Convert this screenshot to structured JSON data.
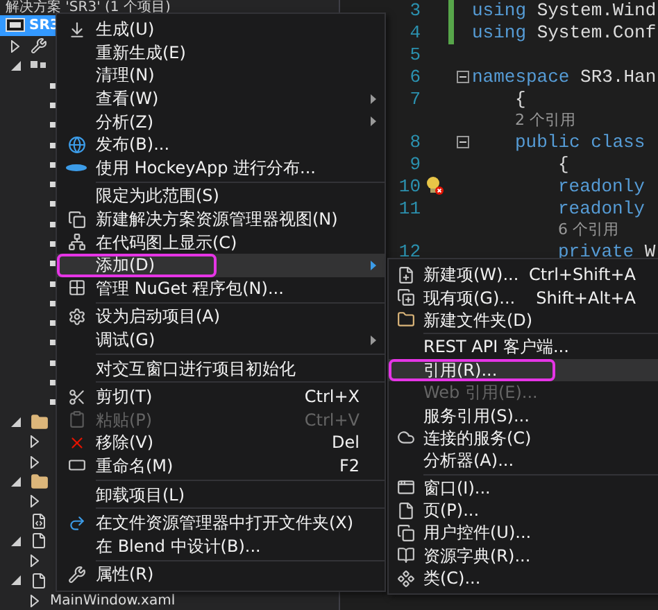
{
  "solution_explorer": {
    "header": "解决方案 'SR3' (1 个项目)",
    "project": {
      "label": "SR3",
      "selected": true
    },
    "items": [
      {
        "kind": "properties",
        "expanded": false
      },
      {
        "kind": "references",
        "expanded": true,
        "children": [
          {
            "kind": "reference"
          },
          {
            "kind": "reference"
          },
          {
            "kind": "reference"
          },
          {
            "kind": "reference"
          },
          {
            "kind": "reference"
          },
          {
            "kind": "reference"
          },
          {
            "kind": "reference"
          },
          {
            "kind": "reference"
          },
          {
            "kind": "reference"
          },
          {
            "kind": "reference"
          },
          {
            "kind": "reference"
          },
          {
            "kind": "reference"
          },
          {
            "kind": "reference"
          },
          {
            "kind": "reference"
          },
          {
            "kind": "reference"
          },
          {
            "kind": "reference"
          },
          {
            "kind": "reference"
          }
        ]
      },
      {
        "kind": "folder",
        "expanded": true,
        "children": [
          {
            "kind": "hidden",
            "expanded": false
          },
          {
            "kind": "hidden",
            "expanded": false
          }
        ]
      },
      {
        "kind": "folder",
        "expanded": true,
        "children": [
          {
            "kind": "hidden",
            "expanded": false
          }
        ]
      },
      {
        "kind": "config"
      },
      {
        "kind": "file",
        "expanded": true,
        "children": [
          {
            "kind": "hidden",
            "expanded": false
          }
        ]
      },
      {
        "kind": "file",
        "expanded": true,
        "children": [
          {
            "kind": "hidden",
            "expanded": false,
            "label": "MainWindow.xaml"
          }
        ]
      }
    ]
  },
  "editor": {
    "lines": [
      {
        "kind": "code",
        "number": "3",
        "keyword": "using",
        "rest": " System.Wind",
        "modified": true
      },
      {
        "kind": "code",
        "number": "4",
        "keyword": "using",
        "rest": " System.Conf",
        "modified": true
      },
      {
        "kind": "code",
        "number": "5",
        "modified": false
      },
      {
        "kind": "code",
        "number": "6",
        "keyword": "namespace",
        "rest": " SR3.Han",
        "modified": false,
        "children": [
          {
            "kind": "code",
            "number": "7",
            "rest": "{",
            "modified": false
          },
          {
            "kind": "lens",
            "text": "2 个引用"
          },
          {
            "kind": "code",
            "number": "8",
            "keyword": "public class",
            "modified": false,
            "children": [
              {
                "kind": "code",
                "number": "9",
                "rest": "{",
                "modified": false
              },
              {
                "kind": "code",
                "number": "10",
                "keyword": "readonly",
                "modified": false,
                "lightbulb": true
              },
              {
                "kind": "code",
                "number": "11",
                "keyword": "readonly",
                "modified": false
              },
              {
                "kind": "lens",
                "text": "6 个引用"
              },
              {
                "kind": "code",
                "number": "12",
                "keyword": "private",
                "rest": " W",
                "modified": false
              }
            ]
          }
        ]
      }
    ]
  },
  "context_menu": [
    {
      "kind": "item",
      "label": "生成(U)",
      "disabled": false,
      "has_submenu": false,
      "selected": false,
      "outlined": false
    },
    {
      "kind": "item",
      "label": "重新生成(E)",
      "disabled": false,
      "has_submenu": false,
      "selected": false,
      "outlined": false
    },
    {
      "kind": "item",
      "label": "清理(N)",
      "disabled": false,
      "has_submenu": false,
      "selected": false,
      "outlined": false
    },
    {
      "kind": "item",
      "label": "查看(W)",
      "disabled": false,
      "has_submenu": true,
      "selected": false,
      "outlined": false
    },
    {
      "kind": "item",
      "label": "分析(Z)",
      "disabled": false,
      "has_submenu": true,
      "selected": false,
      "outlined": false
    },
    {
      "kind": "item",
      "label": "发布(B)...",
      "disabled": false,
      "has_submenu": false,
      "selected": false,
      "outlined": false
    },
    {
      "kind": "item",
      "label": "使用 HockeyApp 进行分布...",
      "disabled": false,
      "has_submenu": false,
      "selected": false,
      "outlined": false
    },
    {
      "kind": "separator"
    },
    {
      "kind": "item",
      "label": "限定为此范围(S)",
      "disabled": false,
      "has_submenu": false,
      "selected": false,
      "outlined": false
    },
    {
      "kind": "item",
      "label": "新建解决方案资源管理器视图(N)",
      "disabled": false,
      "has_submenu": false,
      "selected": false,
      "outlined": false
    },
    {
      "kind": "item",
      "label": "在代码图上显示(C)",
      "disabled": false,
      "has_submenu": false,
      "selected": false,
      "outlined": false
    },
    {
      "kind": "item",
      "label": "添加(D)",
      "disabled": false,
      "has_submenu": true,
      "selected": true,
      "outlined": true
    },
    {
      "kind": "item",
      "label": "管理 NuGet 程序包(N)...",
      "disabled": false,
      "has_submenu": false,
      "selected": false,
      "outlined": false
    },
    {
      "kind": "separator"
    },
    {
      "kind": "item",
      "label": "设为启动项目(A)",
      "disabled": false,
      "has_submenu": false,
      "selected": false,
      "outlined": false
    },
    {
      "kind": "item",
      "label": "调试(G)",
      "disabled": false,
      "has_submenu": true,
      "selected": false,
      "outlined": false
    },
    {
      "kind": "separator"
    },
    {
      "kind": "item",
      "label": "对交互窗口进行项目初始化",
      "disabled": false,
      "has_submenu": false,
      "selected": false,
      "outlined": false
    },
    {
      "kind": "separator"
    },
    {
      "kind": "item",
      "label": "剪切(T)",
      "shortcut": "Ctrl+X",
      "disabled": false,
      "has_submenu": false,
      "selected": false,
      "outlined": false
    },
    {
      "kind": "item",
      "label": "粘贴(P)",
      "shortcut": "Ctrl+V",
      "disabled": true,
      "has_submenu": false,
      "selected": false,
      "outlined": false
    },
    {
      "kind": "item",
      "label": "移除(V)",
      "shortcut": "Del",
      "disabled": false,
      "has_submenu": false,
      "selected": false,
      "outlined": false
    },
    {
      "kind": "item",
      "label": "重命名(M)",
      "shortcut": "F2",
      "disabled": false,
      "has_submenu": false,
      "selected": false,
      "outlined": false
    },
    {
      "kind": "separator"
    },
    {
      "kind": "item",
      "label": "卸载项目(L)",
      "disabled": false,
      "has_submenu": false,
      "selected": false,
      "outlined": false
    },
    {
      "kind": "separator"
    },
    {
      "kind": "item",
      "label": "在文件资源管理器中打开文件夹(X)",
      "disabled": false,
      "has_submenu": false,
      "selected": false,
      "outlined": false
    },
    {
      "kind": "item",
      "label": "在 Blend 中设计(B)...",
      "disabled": false,
      "has_submenu": false,
      "selected": false,
      "outlined": false
    },
    {
      "kind": "separator"
    },
    {
      "kind": "item",
      "label": "属性(R)",
      "disabled": false,
      "has_submenu": false,
      "selected": false,
      "outlined": false
    }
  ],
  "add_submenu": [
    {
      "kind": "item",
      "label": "新建项(W)...",
      "shortcut": "Ctrl+Shift+A",
      "disabled": false,
      "selected": false,
      "outlined": false
    },
    {
      "kind": "item",
      "label": "现有项(G)...",
      "shortcut": "Shift+Alt+A",
      "disabled": false,
      "selected": false,
      "outlined": false
    },
    {
      "kind": "item",
      "label": "新建文件夹(D)",
      "disabled": false,
      "selected": false,
      "outlined": false
    },
    {
      "kind": "separator"
    },
    {
      "kind": "item",
      "label": "REST API 客户端...",
      "disabled": false,
      "selected": false,
      "outlined": false
    },
    {
      "kind": "item",
      "label": "引用(R)...",
      "disabled": false,
      "selected": true,
      "outlined": true
    },
    {
      "kind": "item",
      "label": "Web 引用(E)...",
      "disabled": true,
      "selected": false,
      "outlined": false
    },
    {
      "kind": "item",
      "label": "服务引用(S)...",
      "disabled": false,
      "selected": false,
      "outlined": false
    },
    {
      "kind": "item",
      "label": "连接的服务(C)",
      "disabled": false,
      "selected": false,
      "outlined": false
    },
    {
      "kind": "item",
      "label": "分析器(A)...",
      "disabled": false,
      "selected": false,
      "outlined": false
    },
    {
      "kind": "separator"
    },
    {
      "kind": "item",
      "label": "窗口(I)...",
      "disabled": false,
      "selected": false,
      "outlined": false
    },
    {
      "kind": "item",
      "label": "页(P)...",
      "disabled": false,
      "selected": false,
      "outlined": false
    },
    {
      "kind": "item",
      "label": "用户控件(U)...",
      "disabled": false,
      "selected": false,
      "outlined": false
    },
    {
      "kind": "item",
      "label": "资源字典(R)...",
      "disabled": false,
      "selected": false,
      "outlined": false
    },
    {
      "kind": "item",
      "label": "类(C)...",
      "disabled": false,
      "selected": false,
      "outlined": false
    }
  ]
}
